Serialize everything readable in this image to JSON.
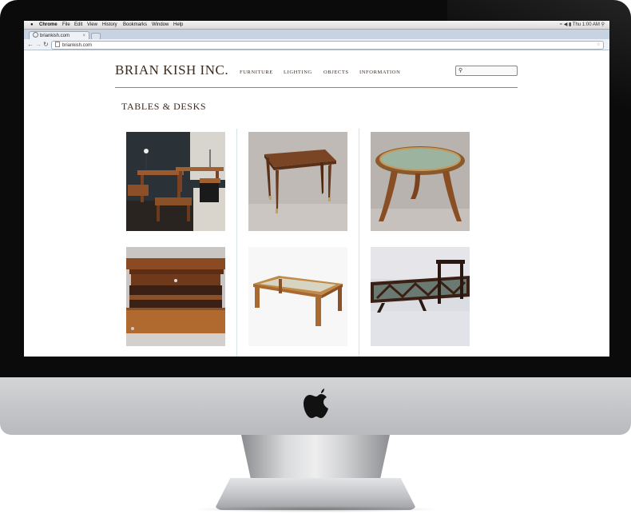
{
  "menubar": {
    "app": "Chrome",
    "items": [
      "File",
      "Edit",
      "View",
      "History",
      "Bookmarks",
      "Window",
      "Help"
    ],
    "clock": "Thu 1:00 AM"
  },
  "browser": {
    "tab_title": "briankish.com",
    "url": "briankish.com"
  },
  "site": {
    "title": "BRIAN KISH INC.",
    "nav": [
      "FURNITURE",
      "LIGHTING",
      "OBJECTS",
      "INFORMATION"
    ],
    "section_title": "TABLES & DESKS"
  },
  "icons": {
    "apple_menu": "apple-icon",
    "search": "magnifier-icon",
    "bookmark": "star-icon"
  },
  "colors": {
    "text_brown": "#3a2a20",
    "divider": "#d6e2e6"
  }
}
